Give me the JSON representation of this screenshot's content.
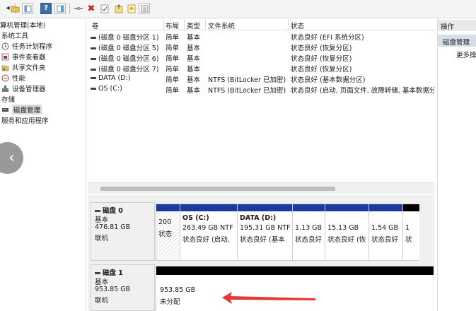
{
  "toolbar": {
    "icons": [
      "back-icon",
      "forward-icon",
      "up-folder-icon",
      "console-tree-icon",
      "help-icon",
      "properties-icon",
      "connect-icon",
      "delete-icon",
      "check-icon",
      "export-icon",
      "wizard-icon",
      "list-view-icon"
    ]
  },
  "tree": {
    "items": [
      {
        "label": "算机管理(本地)",
        "icon": ""
      },
      {
        "label": "系统工具",
        "icon": ""
      },
      {
        "label": "任务计划程序",
        "icon": "clock-icon"
      },
      {
        "label": "事件查看器",
        "icon": "event-viewer-icon"
      },
      {
        "label": "共享文件夹",
        "icon": "shared-folder-icon"
      },
      {
        "label": "性能",
        "icon": "performance-icon"
      },
      {
        "label": "设备管理器",
        "icon": "device-manager-icon"
      },
      {
        "label": "存储",
        "icon": ""
      },
      {
        "label": "磁盘管理",
        "icon": "disk-icon"
      },
      {
        "label": "服务和应用程序",
        "icon": ""
      }
    ]
  },
  "overlay": {
    "back_glyph": "‹"
  },
  "volumes": {
    "columns": [
      "卷",
      "布局",
      "类型",
      "文件系统",
      "状态"
    ],
    "rows": [
      [
        "(磁盘 0 磁盘分区 1)",
        "简单",
        "基本",
        "",
        "状态良好 (EFI 系统分区)"
      ],
      [
        "(磁盘 0 磁盘分区 5)",
        "简单",
        "基本",
        "",
        "状态良好 (恢复分区)"
      ],
      [
        "(磁盘 0 磁盘分区 6)",
        "简单",
        "基本",
        "",
        "状态良好 (恢复分区)"
      ],
      [
        "(磁盘 0 磁盘分区 7)",
        "简单",
        "基本",
        "",
        "状态良好 (恢复分区)"
      ],
      [
        "DATA (D:)",
        "简单",
        "基本",
        "NTFS (BitLocker 已加密)",
        "状态良好 (基本数据分区)"
      ],
      [
        "OS (C:)",
        "简单",
        "基本",
        "NTFS (BitLocker 已加密)",
        "状态良好 (启动, 页面文件, 故障转储, 基本数据分"
      ]
    ]
  },
  "disks": [
    {
      "name": "磁盘 0",
      "type": "基本",
      "size": "476.81 GB",
      "status": "联机",
      "partitions": [
        {
          "name": "",
          "size": "200",
          "status": "状态"
        },
        {
          "name": "OS (C:)",
          "size": "263.49 GB NTF",
          "status": "状态良好 (启动,"
        },
        {
          "name": "DATA (D:)",
          "size": "195.31 GB NTF",
          "status": "状态良好 (基本"
        },
        {
          "name": "",
          "size": "1.13 GB",
          "status": "状态良好"
        },
        {
          "name": "",
          "size": "15.13 GB",
          "status": "状态良好 (恢"
        },
        {
          "name": "",
          "size": "1.54 GB",
          "status": "状态良好"
        },
        {
          "name": "",
          "size": "1",
          "status": "状"
        }
      ]
    },
    {
      "name": "磁盘 1",
      "type": "基本",
      "size": "953.85 GB",
      "status": "联机",
      "partitions": [
        {
          "name": "",
          "size": "953.85 GB",
          "status": "未分配"
        }
      ]
    }
  ],
  "actions": {
    "header": "操作",
    "item": "磁盘管理",
    "more": "更多操"
  },
  "colors": {
    "primary_partition_bar": "#1c3a9e",
    "unallocated_bar": "#000000",
    "arrow": "#e53935",
    "selection": "#d5dfea"
  }
}
